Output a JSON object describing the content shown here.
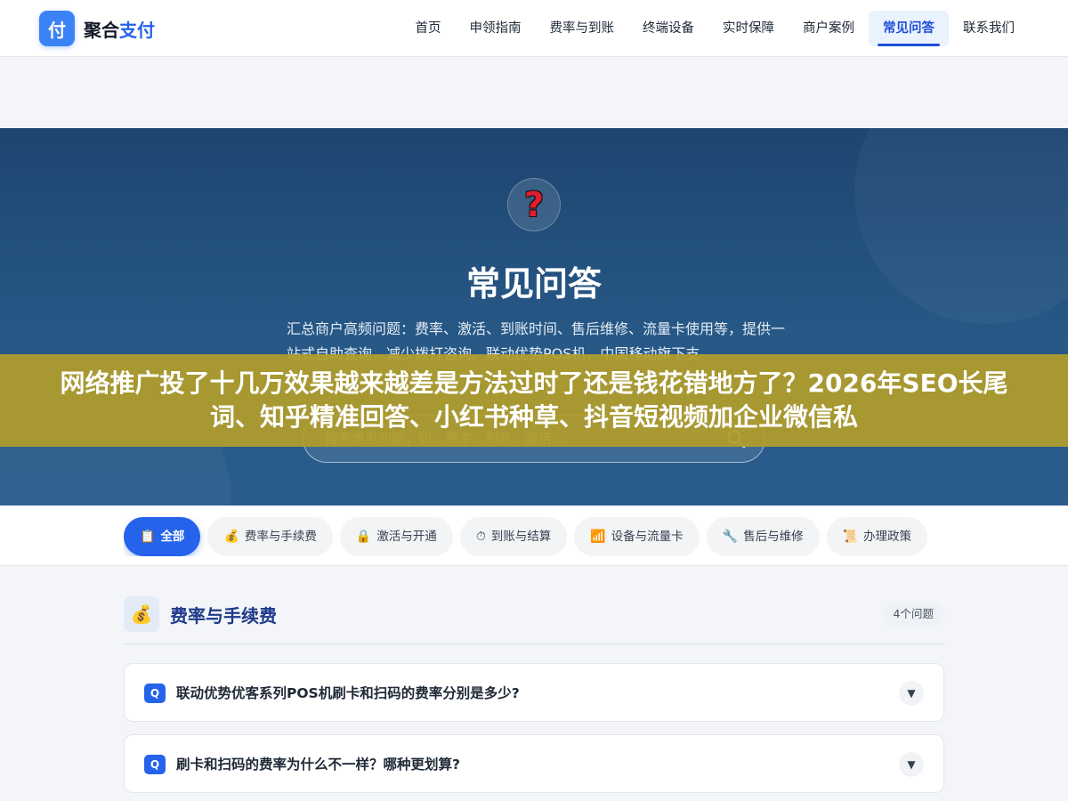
{
  "header": {
    "logo_mark": "付",
    "logo_text_main": "聚合",
    "logo_text_accent": "支付",
    "nav": [
      {
        "label": "首页"
      },
      {
        "label": "申领指南"
      },
      {
        "label": "费率与到账"
      },
      {
        "label": "终端设备"
      },
      {
        "label": "实时保障"
      },
      {
        "label": "商户案例"
      },
      {
        "label": "常见问答",
        "active": true
      },
      {
        "label": "联系我们"
      }
    ]
  },
  "hero": {
    "icon": "?",
    "title": "常见问答",
    "description": "汇总商户高频问题：费率、激活、到账时间、售后维修、流量卡使用等，提供一站式自助查询，减少拨打咨询。联动优势POS机，中国移动旗下支",
    "search_placeholder": "搜索常见问题，如：费率、到账、激活..."
  },
  "overlay": {
    "text": "网络推广投了十几万效果越来越差是方法过时了还是钱花错地方了？2026年SEO长尾词、知乎精准回答、小红书种草、抖音短视频加企业微信私"
  },
  "filters": [
    {
      "icon": "📋",
      "label": "全部",
      "active": true
    },
    {
      "icon": "💰",
      "label": "费率与手续费"
    },
    {
      "icon": "🔒",
      "label": "激活与开通"
    },
    {
      "icon": "⏱",
      "label": "到账与结算"
    },
    {
      "icon": "📶",
      "label": "设备与流量卡"
    },
    {
      "icon": "🔧",
      "label": "售后与维修"
    },
    {
      "icon": "📜",
      "label": "办理政策"
    }
  ],
  "section": {
    "icon": "💰",
    "title": "费率与手续费",
    "count": "4个问题"
  },
  "faqs": [
    {
      "badge": "Q",
      "question": "联动优势优客系列POS机刷卡和扫码的费率分别是多少?",
      "toggle": "▼"
    },
    {
      "badge": "Q",
      "question": "刷卡和扫码的费率为什么不一样？哪种更划算?",
      "toggle": "▼"
    }
  ],
  "colors": {
    "primary": "#2563eb",
    "hero_bg": "#275886",
    "overlay": "#b29d2a"
  }
}
